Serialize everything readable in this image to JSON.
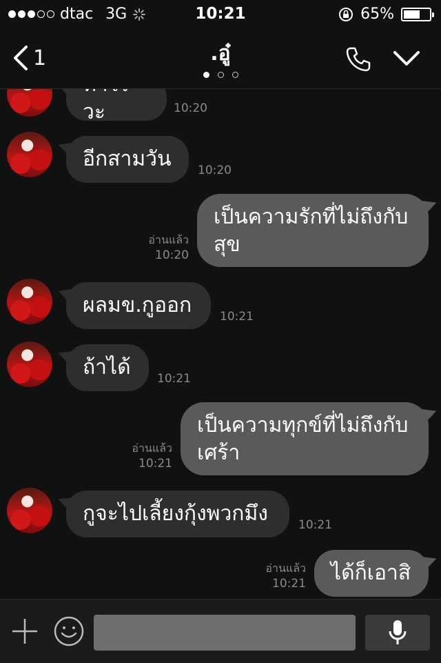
{
  "status_bar": {
    "carrier": "dtac",
    "network": "3G",
    "time": "10:21",
    "battery": "65%",
    "battery_level": 0.65
  },
  "nav": {
    "back_count": "1",
    "title": ".อู๋",
    "page_count": 3,
    "active_page": 1
  },
  "messages": [
    {
      "dir": "in",
      "text": "ทำไรวะ",
      "time": "10:20"
    },
    {
      "dir": "in",
      "text": "อีกสามวัน",
      "time": "10:20"
    },
    {
      "dir": "out",
      "text": "เป็นความรักที่ไม่ถึงกับสุข",
      "read": "อ่านแล้ว",
      "time": "10:20"
    },
    {
      "dir": "in",
      "text": "ผลมข.กูออก",
      "time": "10:21"
    },
    {
      "dir": "in",
      "text": "ถ้าได้",
      "time": "10:21"
    },
    {
      "dir": "out",
      "text": "เป็นความทุกข์ที่ไม่ถึงกับเศร้า",
      "read": "อ่านแล้ว",
      "time": "10:21"
    },
    {
      "dir": "in",
      "text": "กูจะไปเลี้ยงกุ้งพวกมึง",
      "time": "10:21"
    },
    {
      "dir": "out",
      "text": "ได้ก็เอาสิ",
      "read": "อ่านแล้ว",
      "time": "10:21"
    }
  ],
  "input": {
    "placeholder": ""
  },
  "icons": {
    "back": "chevron-left-icon",
    "call": "phone-icon",
    "expand": "chevron-down-icon",
    "add": "plus-icon",
    "sticker": "smiley-icon",
    "voice": "microphone-icon"
  }
}
